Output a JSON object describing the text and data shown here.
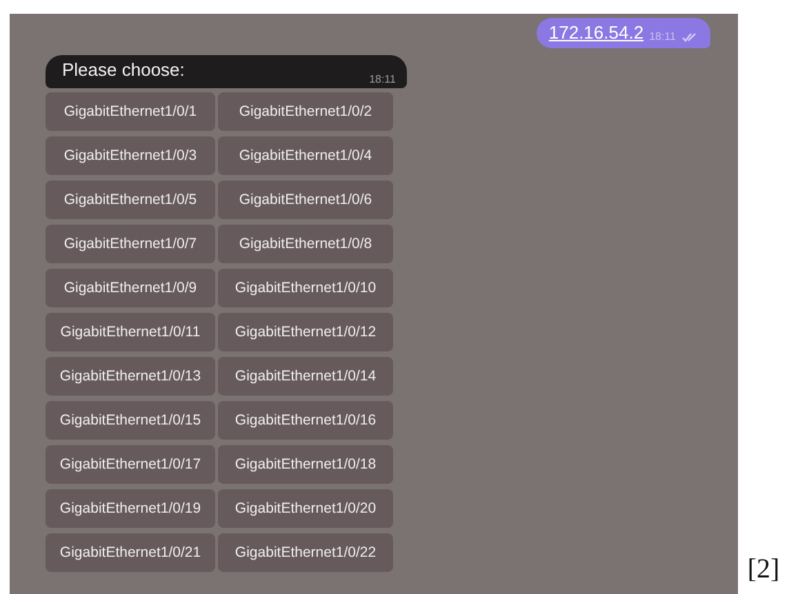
{
  "sent_message": {
    "text": "172.16.54.2",
    "time": "18:11",
    "read": true
  },
  "bot_message": {
    "text": "Please choose:",
    "time": "18:11"
  },
  "buttons": [
    [
      "GigabitEthernet1/0/1",
      "GigabitEthernet1/0/2"
    ],
    [
      "GigabitEthernet1/0/3",
      "GigabitEthernet1/0/4"
    ],
    [
      "GigabitEthernet1/0/5",
      "GigabitEthernet1/0/6"
    ],
    [
      "GigabitEthernet1/0/7",
      "GigabitEthernet1/0/8"
    ],
    [
      "GigabitEthernet1/0/9",
      "GigabitEthernet1/0/10"
    ],
    [
      "GigabitEthernet1/0/11",
      "GigabitEthernet1/0/12"
    ],
    [
      "GigabitEthernet1/0/13",
      "GigabitEthernet1/0/14"
    ],
    [
      "GigabitEthernet1/0/15",
      "GigabitEthernet1/0/16"
    ],
    [
      "GigabitEthernet1/0/17",
      "GigabitEthernet1/0/18"
    ],
    [
      "GigabitEthernet1/0/19",
      "GigabitEthernet1/0/20"
    ],
    [
      "GigabitEthernet1/0/21",
      "GigabitEthernet1/0/22"
    ]
  ],
  "footnote": "[2]"
}
